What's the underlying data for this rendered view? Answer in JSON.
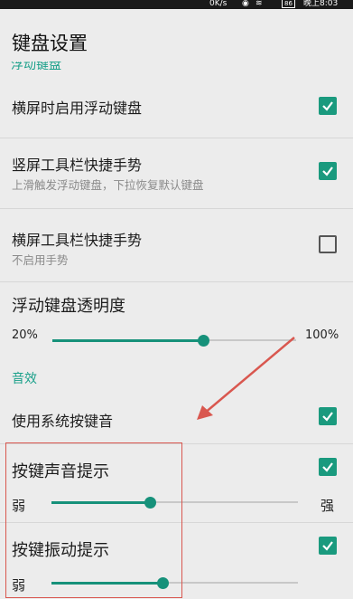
{
  "status": {
    "speed": "0K/s",
    "battery": "86",
    "time": "晚上8:03"
  },
  "appbar": {
    "title": "键盘设置"
  },
  "cut_section_header": "浮动键盘",
  "rows": {
    "landscape_floating": {
      "title": "横屏时启用浮动键盘",
      "checked": true
    },
    "portrait_gesture": {
      "title": "竖屏工具栏快捷手势",
      "summary": "上滑触发浮动键盘，下拉恢复默认键盘",
      "checked": true
    },
    "landscape_gesture": {
      "title": "横屏工具栏快捷手势",
      "summary": "不启用手势",
      "checked": false
    },
    "transparency": {
      "title": "浮动键盘透明度",
      "min_label": "20%",
      "max_label": "100%",
      "value_fraction": 0.62
    }
  },
  "sound_section": {
    "header": "音效",
    "system_key_sound": {
      "title": "使用系统按键音",
      "checked": true
    },
    "key_sound": {
      "title": "按键声音提示",
      "checked": true,
      "min_label": "弱",
      "max_label": "强",
      "value_fraction": 0.4
    },
    "key_vibration": {
      "title": "按键振动提示",
      "checked": true,
      "min_label": "弱",
      "value_fraction": 0.45
    }
  },
  "colors": {
    "accent": "#1a9a7e",
    "annotation": "#d9574f"
  }
}
